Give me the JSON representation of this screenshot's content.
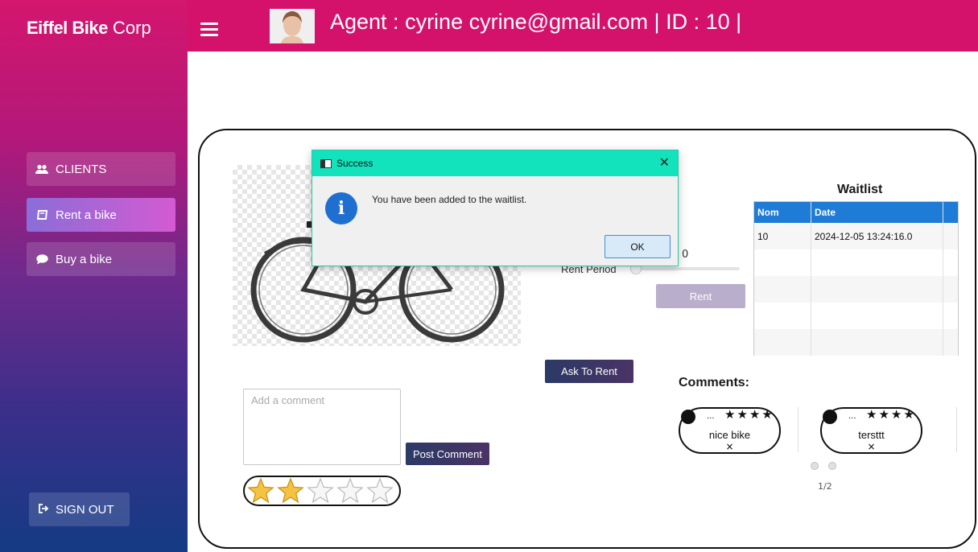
{
  "brand": {
    "bold": "Eiffel Bike",
    "regular": "Corp"
  },
  "header": {
    "agent_text": "Agent : cyrine cyrine@gmail.com | ID : 10 |"
  },
  "sidebar": {
    "items": [
      {
        "label": "CLIENTS",
        "icon": "users-icon"
      },
      {
        "label": "Rent a bike",
        "icon": "book-icon"
      },
      {
        "label": "Buy a bike",
        "icon": "comment-icon"
      }
    ],
    "signout_label": "SIGN OUT"
  },
  "rent": {
    "period_label": "Rent Period",
    "period_value": "0",
    "rent_button": "Rent",
    "ask_button": "Ask To Rent"
  },
  "waitlist": {
    "title": "Waitlist",
    "columns": [
      "Nom",
      "Date"
    ],
    "rows": [
      {
        "nom": "10",
        "date": "2024-12-05 13:24:16.0"
      }
    ]
  },
  "comments": {
    "title": "Comments:",
    "items": [
      {
        "dots": "...",
        "stars": "★★★★",
        "text": "nice bike",
        "remove": "×"
      },
      {
        "dots": "...",
        "stars": "★★★★",
        "text": "tersttt",
        "remove": "×"
      }
    ],
    "pager": "1/2"
  },
  "add_comment": {
    "placeholder": "Add a comment",
    "post_button": "Post Comment",
    "rating": 2,
    "rating_max": 5
  },
  "dialog": {
    "title": "Success",
    "message": "You have been added to the waitlist.",
    "ok_button": "OK",
    "close_glyph": "✕",
    "info_glyph": "i"
  },
  "colors": {
    "topbar": "#d4116b",
    "dialog_title": "#12e3bd",
    "table_header": "#1e7bd6",
    "star_filled": "#f5c242"
  }
}
